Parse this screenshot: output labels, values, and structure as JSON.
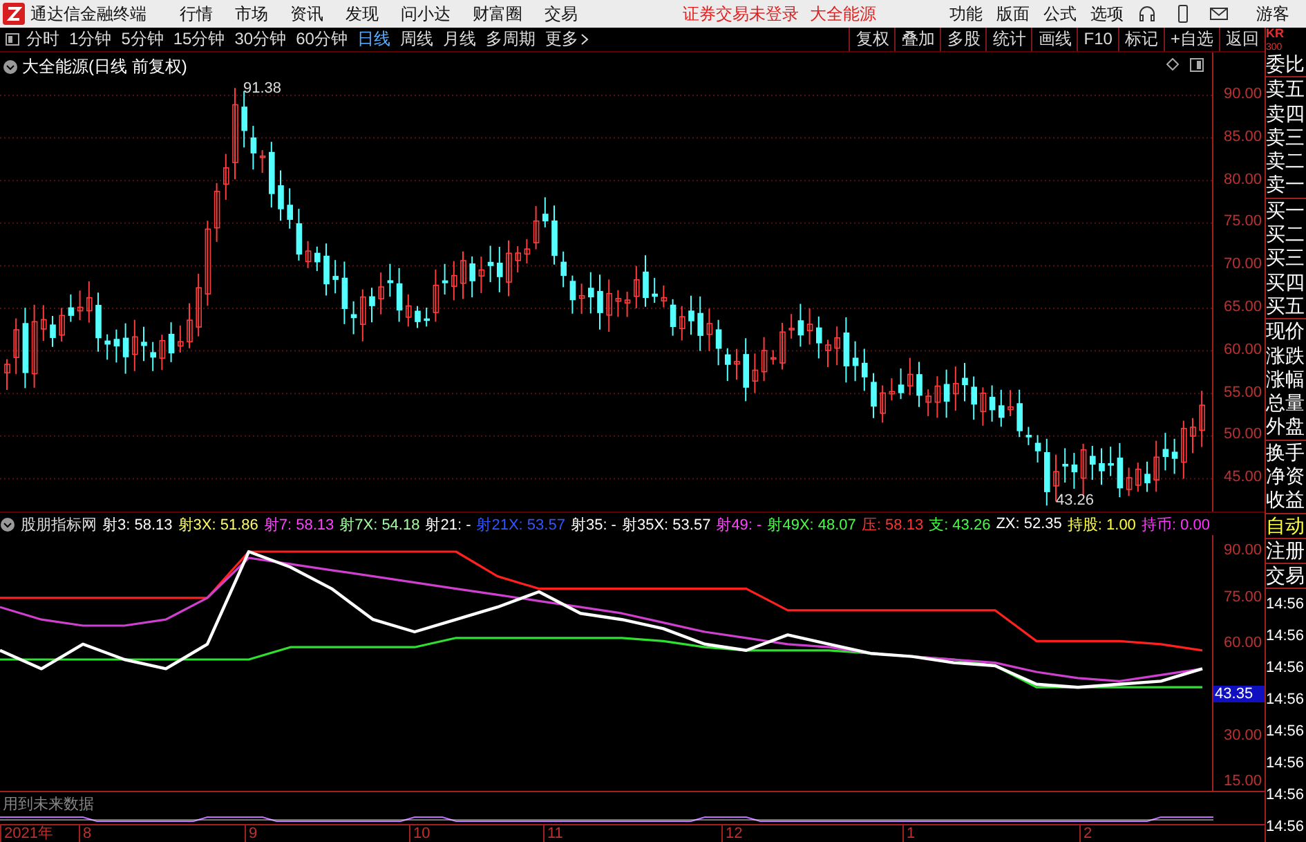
{
  "app": {
    "title": "通达信金融终端",
    "menu": [
      "行情",
      "市场",
      "资讯",
      "发现",
      "问小达",
      "财富圈",
      "交易"
    ],
    "notice": "证券交易未登录",
    "stock": "大全能源",
    "tools": [
      "功能",
      "版面",
      "公式",
      "选项"
    ],
    "user": "游客"
  },
  "periods": [
    {
      "label": "分时",
      "selected": false
    },
    {
      "label": "1分钟",
      "selected": false
    },
    {
      "label": "5分钟",
      "selected": false
    },
    {
      "label": "15分钟",
      "selected": false
    },
    {
      "label": "30分钟",
      "selected": false
    },
    {
      "label": "60分钟",
      "selected": false
    },
    {
      "label": "日线",
      "selected": true
    },
    {
      "label": "周线",
      "selected": false
    },
    {
      "label": "月线",
      "selected": false
    },
    {
      "label": "多周期",
      "selected": false
    }
  ],
  "more": "更多",
  "actions": [
    "复权",
    "叠加",
    "多股",
    "统计",
    "画线",
    "F10",
    "标记",
    "+自选",
    "返回"
  ],
  "code_badge": {
    "line_1": "KR",
    "line_2": "300"
  },
  "main_chart": {
    "title": "大全能源(日线 前复权)",
    "y_axis": [
      "90.00",
      "85.00",
      "80.00",
      "75.00",
      "70.00",
      "65.00",
      "60.00",
      "55.00",
      "50.00",
      "45.00"
    ],
    "high_label": "91.38",
    "low_label": "43.26"
  },
  "quote_panel": {
    "labels": [
      "委比",
      "卖五",
      "卖四",
      "卖三",
      "卖二",
      "卖一",
      "买一",
      "买二",
      "买三",
      "买四",
      "买五",
      "现价",
      "涨跌",
      "涨幅",
      "总量",
      "外盘",
      "换手",
      "净资",
      "收益"
    ],
    "actions": [
      "自动",
      "注册",
      "交易"
    ],
    "times": [
      "14:56",
      "14:56",
      "14:56",
      "14:56",
      "14:56",
      "14:56",
      "14:56",
      "14:56"
    ]
  },
  "indicator": {
    "name": "股朋指标网",
    "legend": [
      {
        "label": "射3: 58.13",
        "color": "#ffffff"
      },
      {
        "label": "射3X: 51.86",
        "color": "#ffff66"
      },
      {
        "label": "射7: 58.13",
        "color": "#ff44ff"
      },
      {
        "label": "射7X: 54.18",
        "color": "#a0ffa0"
      },
      {
        "label": "射21: -",
        "color": "#ffffff"
      },
      {
        "label": "射21X: 53.57",
        "color": "#3355ff"
      },
      {
        "label": "射35: -",
        "color": "#ffffff"
      },
      {
        "label": "射35X: 53.57",
        "color": "#ffffff"
      },
      {
        "label": "射49: -",
        "color": "#ff44ff"
      },
      {
        "label": "射49X: 48.07",
        "color": "#44ff44"
      },
      {
        "label": "压: 58.13",
        "color": "#ff3333"
      },
      {
        "label": "支: 43.26",
        "color": "#44ff44"
      },
      {
        "label": "ZX: 52.35",
        "color": "#ffffff"
      },
      {
        "label": "持股: 1.00",
        "color": "#ffff33"
      },
      {
        "label": "持币: 0.00",
        "color": "#ff33ff"
      }
    ],
    "current": "43.35",
    "warning": "用到未来数据",
    "chart_data": {
      "type": "line",
      "ylim": [
        12.42,
        95.38
      ],
      "yticks": [
        {
          "value": 15,
          "label": "15.00"
        },
        {
          "value": 30,
          "label": "30.00"
        },
        {
          "value": 60,
          "label": "60.00"
        },
        {
          "value": 75,
          "label": "75.00"
        },
        {
          "value": 90,
          "label": "90.00"
        }
      ],
      "series": [
        {
          "color": "#ff2020",
          "values": [
            75,
            75,
            75,
            75,
            75,
            75,
            90,
            90,
            90,
            90,
            90,
            90,
            82,
            78,
            78,
            78,
            78,
            78,
            78,
            71,
            71,
            71,
            71,
            71,
            71,
            61,
            61,
            61,
            60,
            58
          ]
        },
        {
          "color": "#30e030",
          "values": [
            55,
            55,
            55,
            55,
            55,
            55,
            55,
            59,
            59,
            59,
            59,
            62,
            62,
            62,
            62,
            62,
            61,
            59,
            58,
            58,
            58,
            57,
            56,
            55,
            53,
            46,
            46,
            46,
            46,
            46
          ]
        },
        {
          "color": "#d040d0",
          "values": [
            72,
            68,
            66,
            66,
            68,
            75,
            88,
            86,
            84,
            82,
            80,
            78,
            76,
            74,
            72,
            70,
            67,
            64,
            62,
            60,
            59,
            57,
            56,
            55,
            54,
            51,
            49,
            48,
            50,
            52
          ]
        },
        {
          "color": "#ffffff",
          "values": [
            58,
            52,
            60,
            55,
            52,
            60,
            90,
            85,
            78,
            68,
            64,
            68,
            72,
            77,
            70,
            68,
            65,
            60,
            58,
            63,
            60,
            57,
            56,
            54,
            53,
            47,
            46,
            47,
            48,
            52
          ]
        }
      ]
    }
  },
  "date_axis": [
    "2021年",
    "8",
    "9",
    "10",
    "11",
    "12",
    "1",
    "2"
  ]
}
